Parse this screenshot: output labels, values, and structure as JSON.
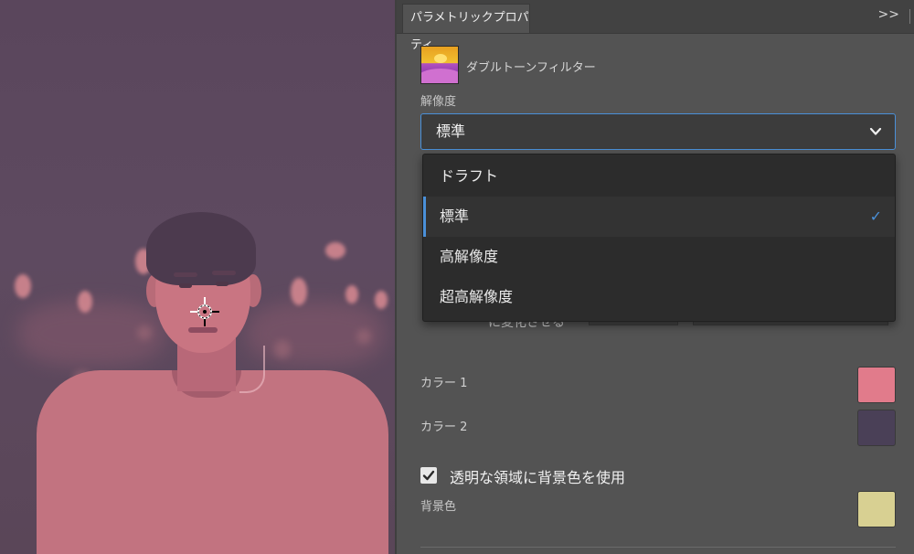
{
  "panel": {
    "tab_title": "パラメトリックプロパティ",
    "collapse_glyph": ">>",
    "filter": {
      "name": "ダブルトーンフィルター",
      "thumb_icon": "duotone-landscape-thumbnail"
    },
    "resolution": {
      "label": "解像度",
      "selected": "標準",
      "options": [
        "ドラフト",
        "標準",
        "高解像度",
        "超高解像度"
      ],
      "check_glyph": "✓"
    },
    "partially_hidden_label": "に変化させる",
    "colors": [
      {
        "label": "カラー 1",
        "value": "#e17b8b"
      },
      {
        "label": "カラー 2",
        "value": "#4a4057"
      }
    ],
    "background": {
      "checkbox_label": "透明な領域に背景色を使用",
      "checked": true,
      "label": "背景色",
      "value": "#d8d092"
    },
    "accent_color": "#4a90d9"
  }
}
